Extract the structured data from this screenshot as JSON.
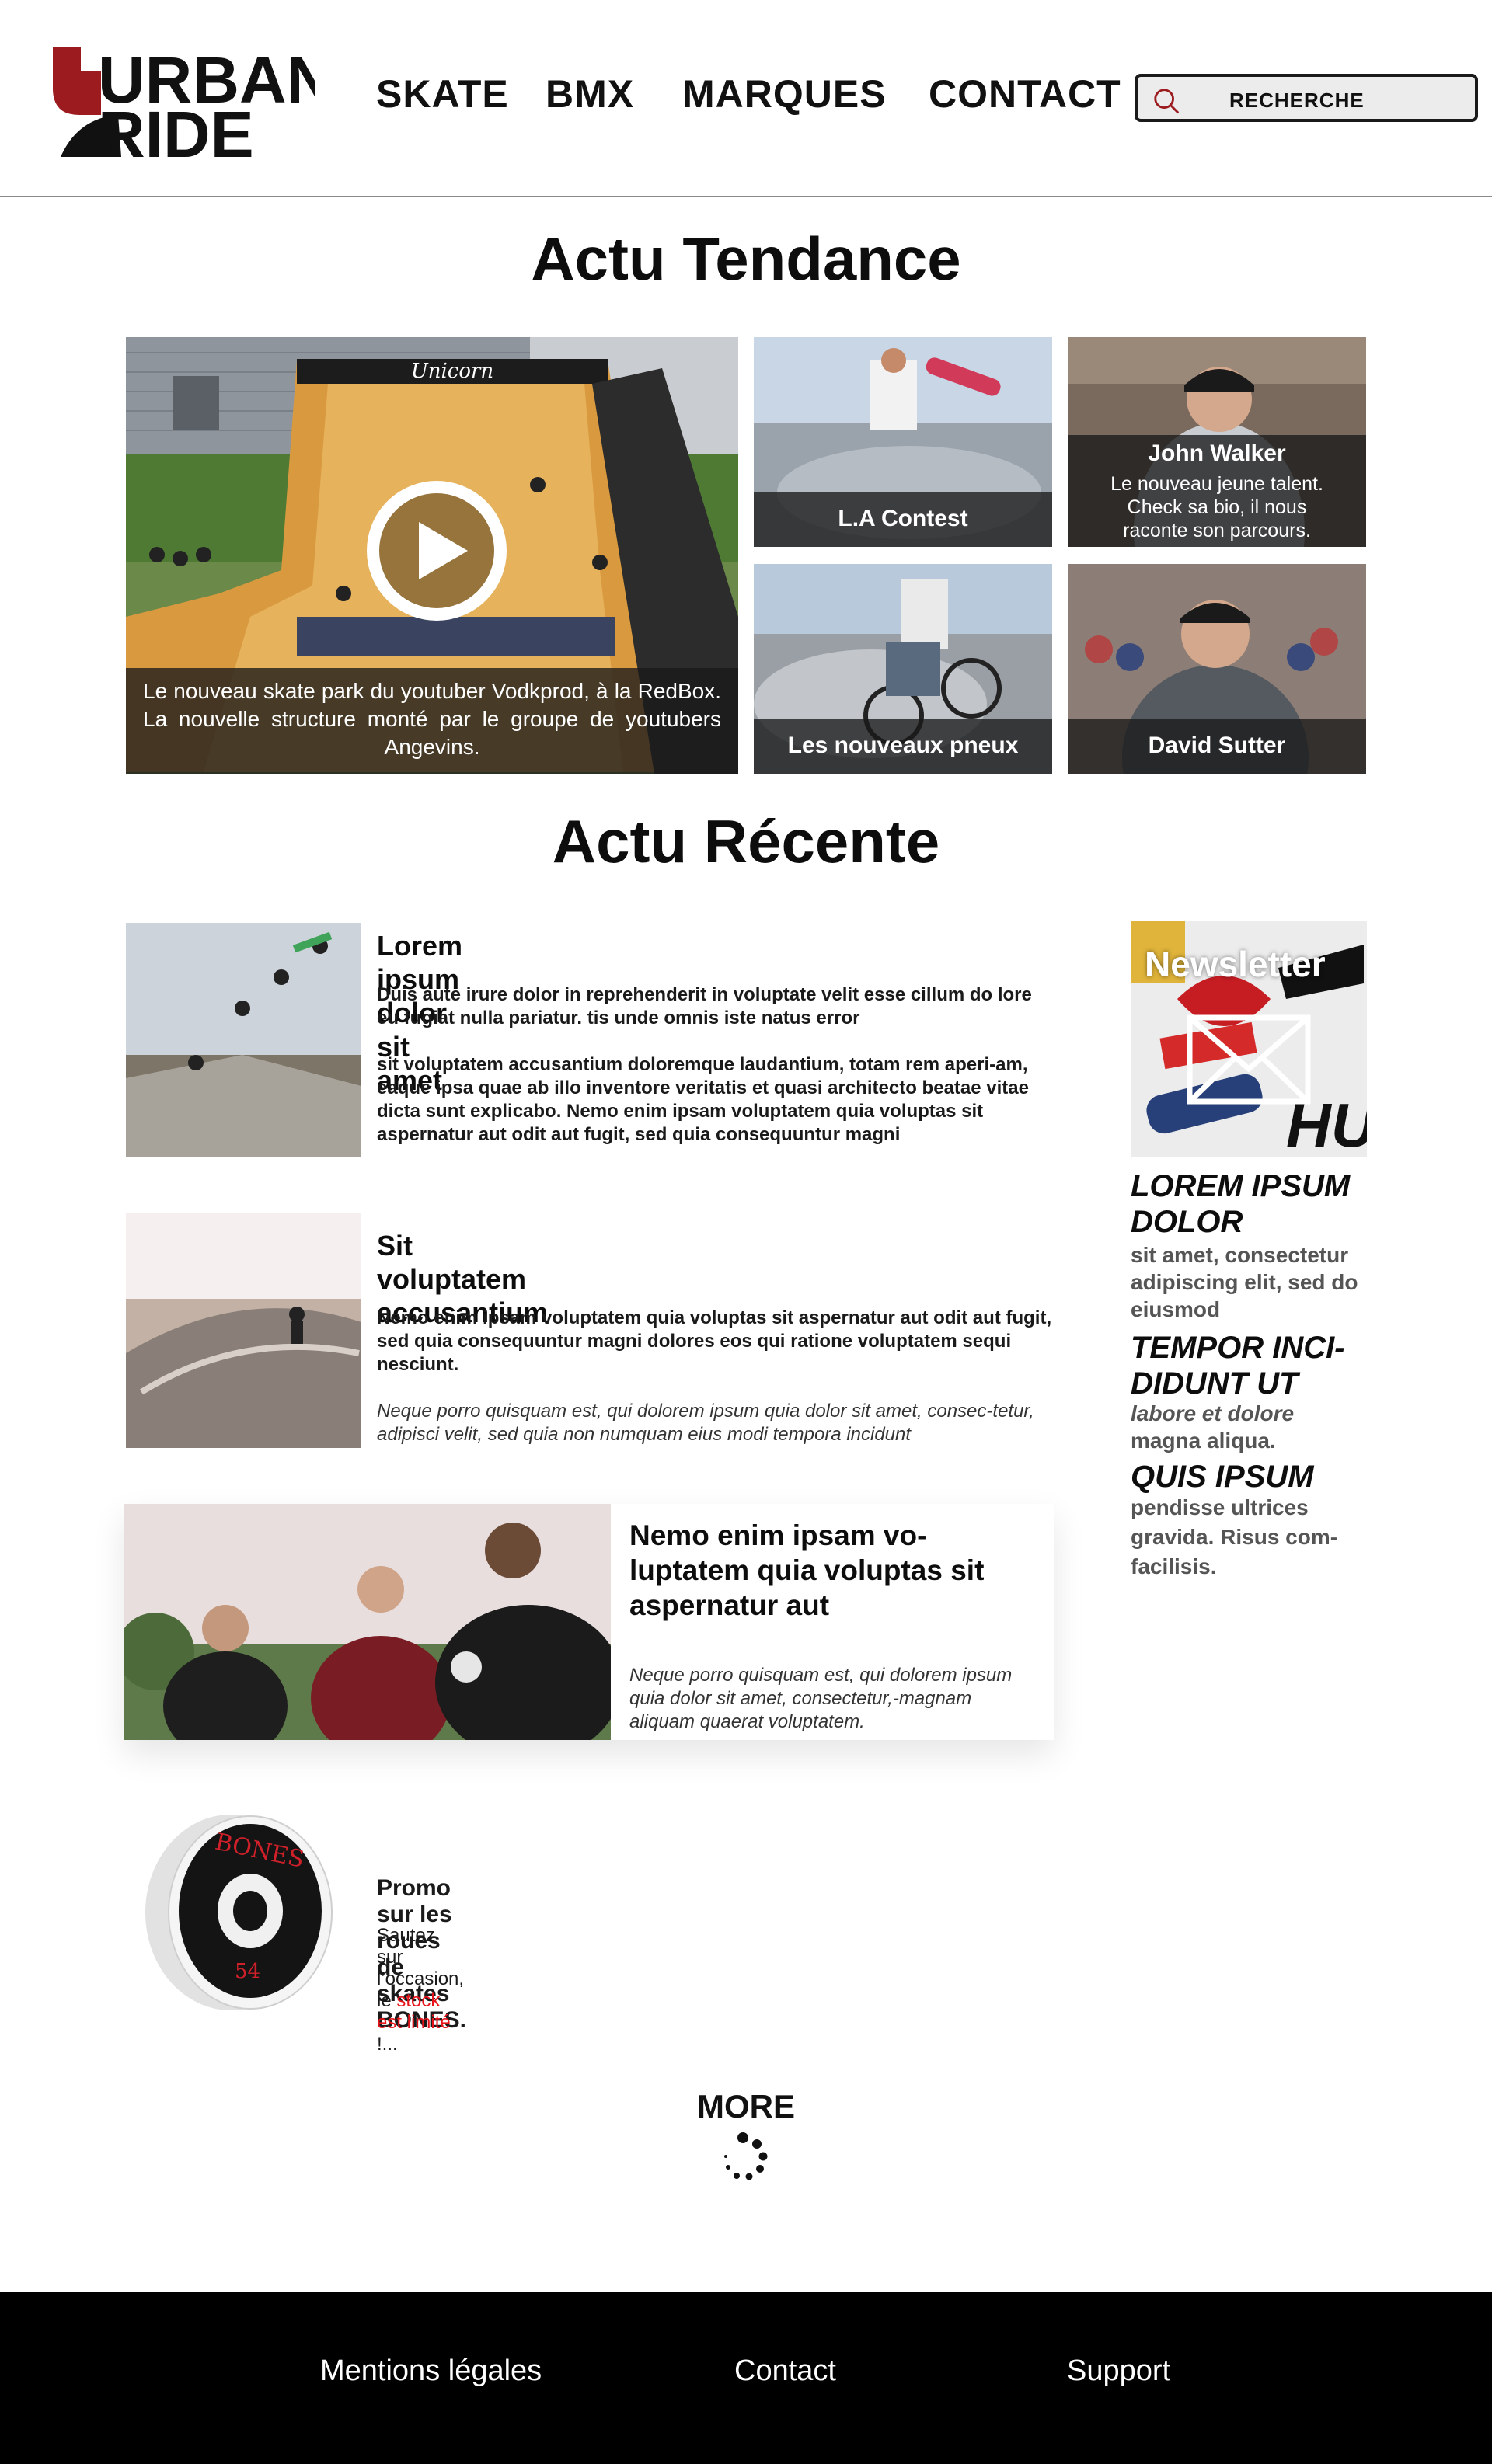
{
  "header": {
    "logo": {
      "line1": "URBAN",
      "line2": "RIDE",
      "accent_color": "#9b1b1e"
    },
    "nav": [
      {
        "label": "SKATE"
      },
      {
        "label": "BMX"
      },
      {
        "label": "MARQUES"
      },
      {
        "label": "CONTACT"
      }
    ],
    "search": {
      "placeholder": "RECHERCHE",
      "icon": "search-icon",
      "icon_color": "#9b1b1e"
    }
  },
  "tendance": {
    "title": "Actu Tendance",
    "feature": {
      "text": "Le nouveau skate park du youtuber Vodkprod, à la RedBox. La nouvelle structure monté par le groupe de youtubers Angevins.",
      "ramp_sign": "Unicorn"
    },
    "tiles": [
      {
        "title": "L.A Contest"
      },
      {
        "title": "John Walker",
        "text": "Le nouveau jeune talent. Check sa bio, il nous raconte son parcours."
      },
      {
        "title": "Les nouveaux pneux"
      },
      {
        "title": "David Sutter"
      }
    ]
  },
  "recente": {
    "title": "Actu Récente",
    "articles": [
      {
        "title": "Lorem ipsum dolor sit amet",
        "body1": "Duis aute irure dolor in reprehenderit in voluptate velit esse cillum do lore eu fugiat nulla pariatur. tis unde omnis iste natus error",
        "body2": " sit voluptatem accusantium doloremque laudantium, totam rem aperi-am, eaque ipsa quae ab illo inventore veritatis et quasi architecto beatae vitae dicta sunt explicabo. Nemo enim ipsam voluptatem quia voluptas sit aspernatur aut odit aut fugit, sed quia consequuntur magni"
      },
      {
        "title": "Sit voluptatem accusantium",
        "body1": "Nemo enim ipsam voluptatem quia voluptas sit aspernatur aut odit aut fugit, sed quia consequuntur magni dolores eos qui ratione voluptatem sequi nesciunt.",
        "body2": "Neque porro quisquam est, qui dolorem ipsum quia dolor sit amet, consec-tetur, adipisci velit, sed quia non numquam eius modi tempora incidunt"
      },
      {
        "title": "Nemo enim ipsam vo-luptatem quia voluptas sit aspernatur aut",
        "body1": "Neque porro quisquam est, qui dolorem ipsum quia dolor sit amet, consectetur,-magnam aliquam quaerat voluptatem."
      }
    ],
    "promo": {
      "title": "Promo sur les roues de skates BONES.",
      "text_before": "Sautez sur l’occasion, le ",
      "highlight": "stock est limité",
      "text_after": " !...",
      "highlight_color": "#e8141b",
      "wheel_brand": "BONES",
      "wheel_size": "54"
    }
  },
  "sidebar": {
    "newsletter": {
      "title": "Newsletter",
      "icon": "mail-icon"
    },
    "block1_title": "LOREM IPSUM DOLOR",
    "block1_text": "sit amet, consectetur adipiscing elit, sed do eiusmod",
    "block2_title": "TEMPOR INCI-DIDUNT UT",
    "block2_italic": "labore et dolore",
    "block2_text": "magna aliqua.",
    "block3_title": "QUIS IPSUM",
    "block3_text": "pendisse ultrices gravida. Risus com-facilisis."
  },
  "more": {
    "label": "MORE",
    "icon": "loading-spinner-icon"
  },
  "footer": {
    "links": [
      {
        "label": "Mentions légales"
      },
      {
        "label": "Contact"
      },
      {
        "label": "Support"
      }
    ]
  }
}
